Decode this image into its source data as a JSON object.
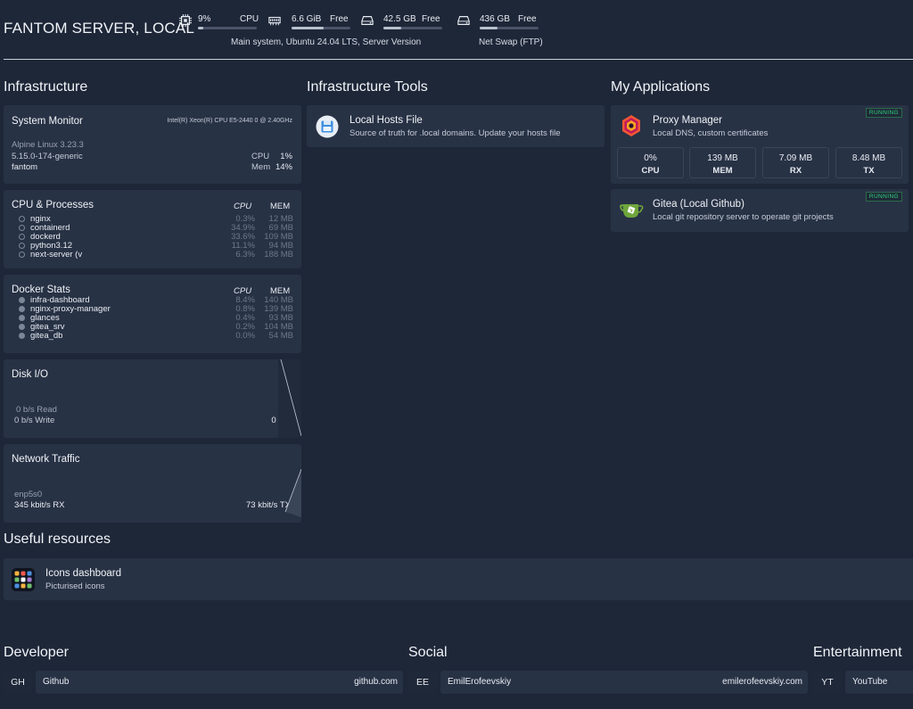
{
  "header": {
    "title": "FANTOM SERVER, LOCAL",
    "stats": [
      {
        "icon": "cpu-chip-icon",
        "value": "9%",
        "label": "CPU",
        "fraction": 0.09
      },
      {
        "icon": "memory-ram-icon",
        "value": "6.6 GiB",
        "label": "Free",
        "fraction": 0.55
      },
      {
        "icon": "hard-drive-icon",
        "value": "42.5 GB",
        "label": "Free",
        "fraction": 0.3
      },
      {
        "icon": "hard-drive-icon",
        "value": "436 GB",
        "label": "Free",
        "fraction": 0.3
      }
    ],
    "main_system_label": "Main system, Ubuntu 24.04 LTS, Server Version",
    "net_swap_label": "Net Swap (FTP)"
  },
  "infrastructure": {
    "title": "Infrastructure",
    "system_monitor": {
      "title": "System Monitor",
      "cpu_model": "Intel(R) Xeon(R) CPU E5-2440 0 @ 2.40GHz",
      "os": "Alpine Linux 3.23.3",
      "kernel": "5.15.0-174-generic",
      "host": "fantom",
      "cpu_label": "CPU",
      "cpu_value": "1%",
      "mem_label": "Mem",
      "mem_value": "14%"
    },
    "cpu_processes": {
      "title": "CPU & Processes",
      "cpu_header": "CPU",
      "mem_header": "MEM",
      "rows": [
        {
          "name": "nginx",
          "cpu": "0.3%",
          "mem": "12 MB"
        },
        {
          "name": "containerd",
          "cpu": "34.9%",
          "mem": "69 MB"
        },
        {
          "name": "dockerd",
          "cpu": "33.6%",
          "mem": "109 MB"
        },
        {
          "name": "python3.12",
          "cpu": "11.1%",
          "mem": "94 MB"
        },
        {
          "name": "next-server (v",
          "cpu": "6.3%",
          "mem": "188 MB"
        }
      ]
    },
    "docker_stats": {
      "title": "Docker Stats",
      "cpu_header": "CPU",
      "mem_header": "MEM",
      "rows": [
        {
          "name": "infra-dashboard",
          "cpu": "8.4%",
          "mem": "140 MB"
        },
        {
          "name": "nginx-proxy-manager",
          "cpu": "0.8%",
          "mem": "139 MB"
        },
        {
          "name": "glances",
          "cpu": "0.4%",
          "mem": "93 MB"
        },
        {
          "name": "gitea_srv",
          "cpu": "0.2%",
          "mem": "104 MB"
        },
        {
          "name": "gitea_db",
          "cpu": "0.0%",
          "mem": "54 MB"
        }
      ]
    },
    "disk_io": {
      "title": "Disk I/O",
      "read": "0 b/s Read",
      "write": "0 b/s Write",
      "total": "0 b/s"
    },
    "network": {
      "title": "Network Traffic",
      "interface": "enp5s0",
      "rx": "345 kbit/s RX",
      "tx": "73 kbit/s TX"
    }
  },
  "tools": {
    "title": "Infrastructure Tools",
    "items": [
      {
        "icon": "floppy-disk-icon",
        "name": "Local Hosts File",
        "description": "Source of truth for .local domains. Update your hosts file"
      }
    ]
  },
  "applications": {
    "title": "My Applications",
    "proxy_manager": {
      "name": "Proxy Manager",
      "description": "Local DNS, custom certificates",
      "status": "RUNNING",
      "metrics": [
        {
          "value": "0%",
          "label": "CPU"
        },
        {
          "value": "139 MB",
          "label": "MEM"
        },
        {
          "value": "7.09 MB",
          "label": "RX"
        },
        {
          "value": "8.48 MB",
          "label": "TX"
        }
      ]
    },
    "gitea": {
      "name": "Gitea (Local Github)",
      "description": "Local git repository server to operate git projects",
      "status": "RUNNING"
    }
  },
  "resources": {
    "title": "Useful resources",
    "items": [
      {
        "name": "Icons dashboard",
        "description": "Picturised icons"
      }
    ]
  },
  "bookmarks": {
    "developer": {
      "title": "Developer",
      "abbr": "GH",
      "name": "Github",
      "url": "github.com"
    },
    "social": {
      "title": "Social",
      "abbr": "EE",
      "name": "EmilErofeevskiy",
      "url": "emilerofeevskiy.com"
    },
    "entertainment": {
      "title": "Entertainment",
      "abbr": "YT",
      "name": "YouTube"
    }
  },
  "colors": {
    "background": "#1e2738",
    "card": "#283245",
    "running": "#31d17c"
  }
}
